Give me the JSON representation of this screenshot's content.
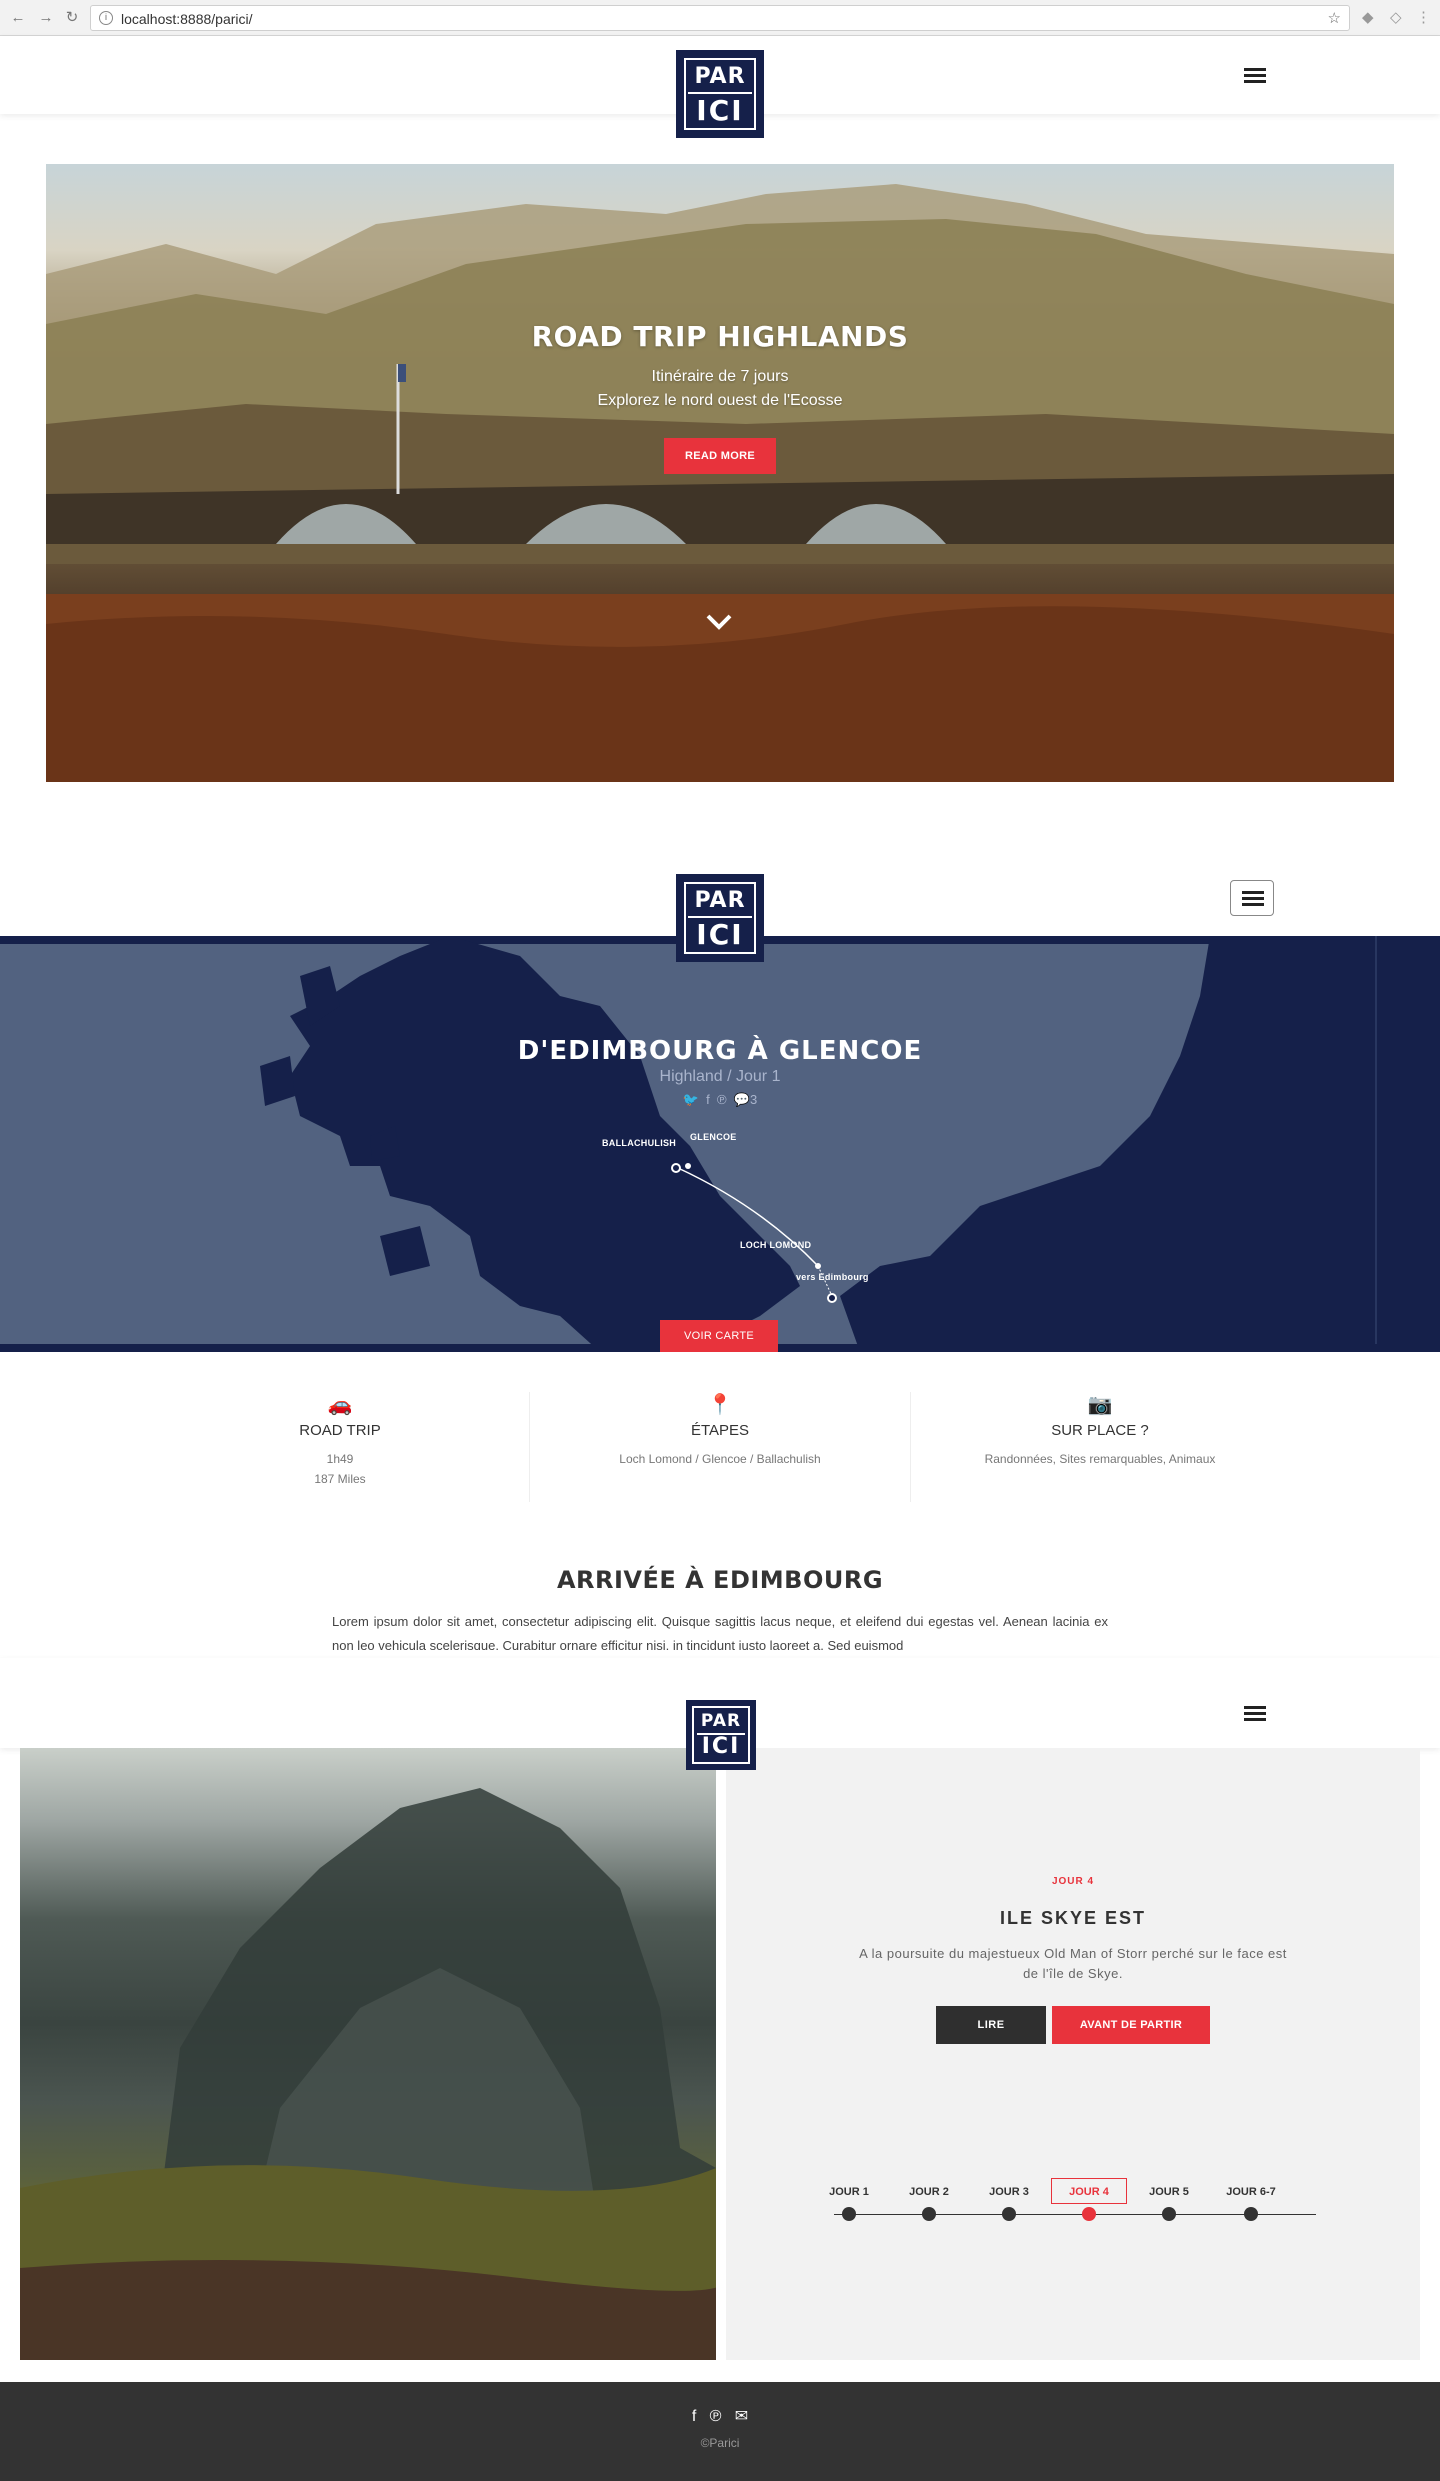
{
  "browser": {
    "url": "localhost:8888/parici/",
    "back_icon": "arrow-left-icon",
    "forward_icon": "arrow-right-icon",
    "reload_icon": "reload-icon"
  },
  "logo": {
    "top": "PAR",
    "bottom": "ICI"
  },
  "hero": {
    "title": "ROAD TRIP HIGHLANDS",
    "line1": "Itinéraire de 7 jours",
    "line2": "Explorez le nord ouest de l'Ecosse",
    "cta": "READ MORE"
  },
  "map": {
    "title": "D'EDIMBOURG À GLENCOE",
    "subtitle": "Highland / Jour 1",
    "comments": "3",
    "labels": {
      "ballachulish": "BALLACHULISH",
      "glencoe": "GLENCOE",
      "loch_lomond": "LOCH LOMOND",
      "edimbourg": "vers Edimbourg"
    },
    "cta": "VOIR CARTE"
  },
  "infos": [
    {
      "icon": "car-icon",
      "title": "ROAD TRIP",
      "line1": "1h49",
      "line2": "187 Miles"
    },
    {
      "icon": "map-pin-icon",
      "title": "ÉTAPES",
      "line1": "Loch Lomond / Glencoe / Ballachulish",
      "line2": ""
    },
    {
      "icon": "camera-icon",
      "title": "SUR PLACE ?",
      "line1": "Randonnées, Sites remarquables, Animaux",
      "line2": ""
    }
  ],
  "arrival": {
    "title": "ARRIVÉE À EDIMBOURG",
    "text": "Lorem ipsum dolor sit amet, consectetur adipiscing elit. Quisque sagittis lacus neque, et eleifend dui egestas vel. Aenean lacinia ex non leo vehicula scelerisque. Curabitur ornare efficitur nisi, in tincidunt justo laoreet a. Sed euismod"
  },
  "day_panel": {
    "day": "JOUR 4",
    "title": "ILE SKYE EST",
    "text": "A la poursuite du majestueux Old Man of Storr perché sur le face est de l'île de Skye.",
    "read": "LIRE",
    "before": "AVANT DE PARTIR",
    "timeline": [
      "JOUR 1",
      "JOUR 2",
      "JOUR 3",
      "JOUR 4",
      "JOUR 5",
      "JOUR 6-7"
    ],
    "active_index": 3
  },
  "footer": {
    "copyright": "©Parici"
  },
  "colors": {
    "navy": "#15204a",
    "red": "#e8333c",
    "map": "#526280",
    "footer": "#333333"
  }
}
